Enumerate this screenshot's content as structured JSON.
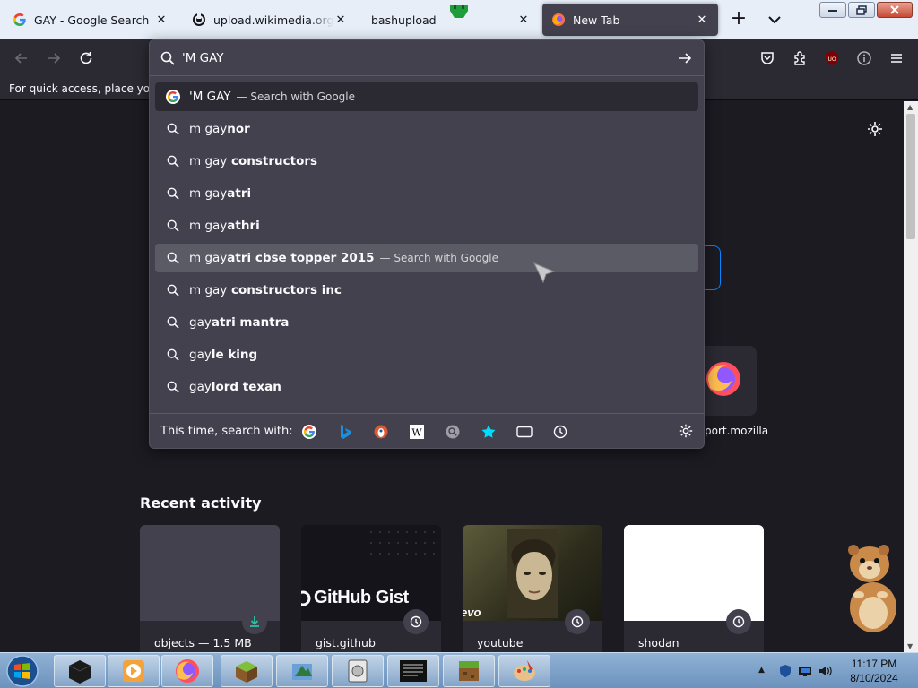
{
  "tabs": [
    {
      "title": "GAY - Google Search",
      "close": "✕"
    },
    {
      "title": "upload.wikimedia.org/wiki",
      "close": "✕"
    },
    {
      "title": "bashupload",
      "close": "✕"
    },
    {
      "title": "New Tab",
      "close": "✕",
      "active": true
    }
  ],
  "tabbar": {
    "new_tab": "+"
  },
  "bookmarks_bar": {
    "hint": "For quick access, place your b"
  },
  "urlbar": {
    "value": "'M GAY",
    "first_result": {
      "text": "'M GAY",
      "action": "— Search with Google"
    },
    "suggestions": [
      {
        "plain": "m gay",
        "bold": "nor",
        "action": ""
      },
      {
        "plain": "m gay",
        "bold": " constructors",
        "action": ""
      },
      {
        "plain": "m gay",
        "bold": "atri",
        "action": ""
      },
      {
        "plain": "m gay",
        "bold": "athri",
        "action": ""
      },
      {
        "plain": "m gay",
        "bold": "atri cbse topper 2015",
        "action": "— Search with Google"
      },
      {
        "plain": "m gay",
        "bold": " constructors inc",
        "action": ""
      },
      {
        "plain": "gay",
        "bold": "atri mantra",
        "action": ""
      },
      {
        "plain": "gay",
        "bold": "le king",
        "action": ""
      },
      {
        "plain": "gay",
        "bold": "lord texan",
        "action": ""
      }
    ],
    "search_with_label": "This time, search with:",
    "engines": [
      "google-icon",
      "bing-icon",
      "duckduckgo-icon",
      "wikipedia-icon",
      "search-engine-icon",
      "bookmarks-star-icon",
      "tabs-icon",
      "history-icon"
    ]
  },
  "newtab": {
    "shortcut_label": "port.mozilla",
    "recent_title": "Recent activity",
    "cards": [
      {
        "caption": "objects — 1.5 MB",
        "badge": "download-icon"
      },
      {
        "caption": "gist.github",
        "badge": "history-icon",
        "thumb_text": "GitHub Gist"
      },
      {
        "caption": "youtube",
        "badge": "history-icon",
        "thumb_text": "evo"
      },
      {
        "caption": "shodan",
        "badge": "history-icon"
      }
    ]
  },
  "taskbar": {
    "time": "11:17 PM",
    "date": "8/10/2024"
  },
  "colors": {
    "panel": "#42414d",
    "toolbar": "#2b2a33",
    "page": "#1c1b22",
    "accent": "#0a84ff",
    "tabstrip": "#e7eef7"
  }
}
